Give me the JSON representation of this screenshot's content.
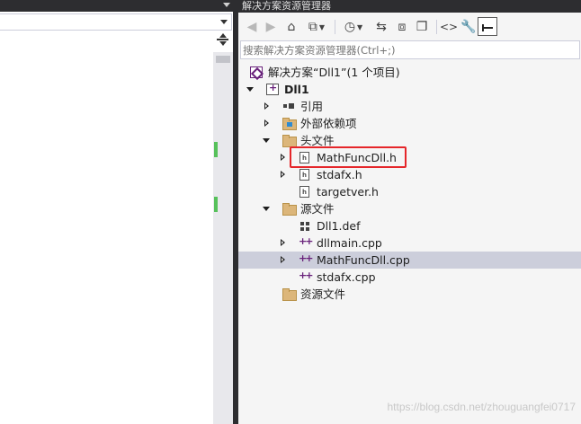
{
  "explorer": {
    "title": "解决方案资源管理器",
    "search_placeholder": "搜索解决方案资源管理器(Ctrl+;)",
    "toolbar_icons": [
      "back-arrow-icon",
      "forward-arrow-icon",
      "home-icon",
      "switch-views-icon",
      "pending-changes-filter-icon",
      "sync-icon",
      "collapse-all-icon",
      "show-all-files-icon",
      "view-code-icon",
      "properties-wrench-icon",
      "auto-hide-pin-icon"
    ]
  },
  "tree": {
    "solution": "解决方案“Dll1”(1 个项目)",
    "project": "Dll1",
    "references": "引用",
    "external_deps": "外部依赖项",
    "header_files": "头文件",
    "headers": [
      "MathFuncDll.h",
      "stdafx.h",
      "targetver.h"
    ],
    "source_files": "源文件",
    "sources": [
      "Dll1.def",
      "dllmain.cpp",
      "MathFuncDll.cpp",
      "stdafx.cpp"
    ],
    "resource_files": "资源文件",
    "selected": "MathFuncDll.cpp",
    "highlighted": "MathFuncDll.h"
  },
  "colors": {
    "selection": "#cccedb",
    "highlight_box": "#e5262a",
    "title_bar": "#2d2d30",
    "change_marker": "#57c15b"
  },
  "watermark": "https://blog.csdn.net/zhouguangfei0717"
}
